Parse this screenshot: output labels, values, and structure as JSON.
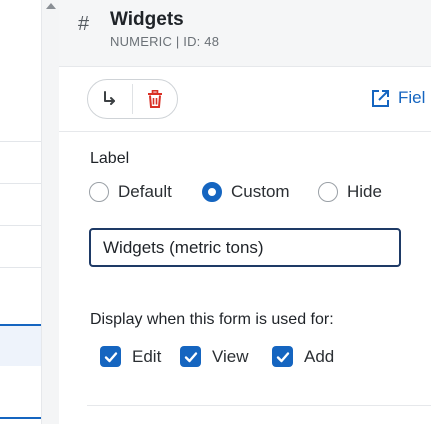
{
  "header": {
    "icon": "hash-icon",
    "title": "Widgets",
    "subtitle": "NUMERIC | ID: 48"
  },
  "toolbar": {
    "move_icon": "move-arrow-icon",
    "delete_icon": "trash-icon",
    "field_link_label": "Fiel",
    "field_link_icon": "external-edit-icon"
  },
  "label_section": {
    "heading": "Label",
    "options": [
      "Default",
      "Custom",
      "Hide"
    ],
    "selected": "Custom",
    "input_value": "Widgets (metric tons)"
  },
  "display_section": {
    "heading": "Display when this form is used for:",
    "checks": [
      {
        "label": "Edit",
        "checked": true
      },
      {
        "label": "View",
        "checked": true
      },
      {
        "label": "Add",
        "checked": true
      }
    ]
  },
  "colors": {
    "accent": "#1565c0",
    "delete_red": "#d93025",
    "header_bg": "#f5f6f7"
  }
}
